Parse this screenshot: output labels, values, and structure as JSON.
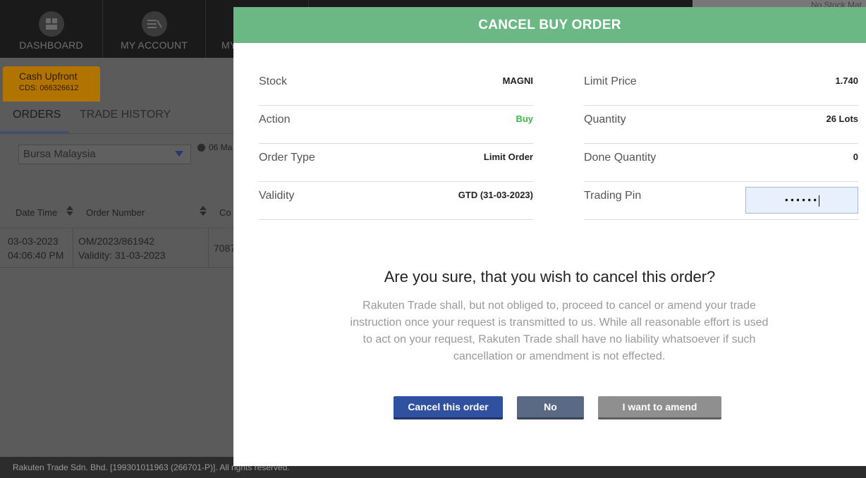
{
  "nav": {
    "items": [
      {
        "label": "DASHBOARD",
        "icon": "dashboard-icon"
      },
      {
        "label": "MY ACCOUNT",
        "icon": "account-icon"
      },
      {
        "label": "MY",
        "icon": ""
      }
    ],
    "top_right_note": "No Stock Mat"
  },
  "account_badge": {
    "title": "Cash Upfront",
    "cds": "CDS: 066326612"
  },
  "tabs": [
    {
      "label": "ORDERS",
      "active": true
    },
    {
      "label": "TRADE HISTORY",
      "active": false
    }
  ],
  "exchange_select": {
    "value": "Bursa Malaysia"
  },
  "date_chip": "06 Ma",
  "orders_table": {
    "headers": [
      "Date Time",
      "Order Number",
      "Co"
    ],
    "rows": [
      {
        "date": "03-03-2023",
        "time": "04:06:40 PM",
        "order_number": "OM/2023/861942",
        "validity": "Validity: 31-03-2023",
        "code": "7087"
      }
    ]
  },
  "footer": "Rakuten Trade Sdn. Bhd. [199301011963 (266701-P)]. All rights reserved.",
  "modal": {
    "title": "CANCEL BUY ORDER",
    "left": [
      {
        "label": "Stock",
        "value": "MAGNI"
      },
      {
        "label": "Action",
        "value": "Buy"
      },
      {
        "label": "Order Type",
        "value": "Limit Order"
      },
      {
        "label": "Validity",
        "value": "GTD (31-03-2023)"
      }
    ],
    "right": [
      {
        "label": "Limit Price",
        "value": "1.740"
      },
      {
        "label": "Quantity",
        "value": "26 Lots"
      },
      {
        "label": "Done Quantity",
        "value": "0"
      },
      {
        "label": "Trading Pin",
        "masked_value": "••••••"
      }
    ],
    "question": "Are you sure, that you wish to cancel this order?",
    "disclaimer": "Rakuten Trade shall, but not obliged to, proceed to cancel or amend your trade instruction once your request is transmitted to us. While all reasonable effort is used to act on your request, Rakuten Trade shall have no liability whatsoever if such cancellation or amendment is not effected.",
    "buttons": {
      "cancel_order": "Cancel this order",
      "no": "No",
      "amend": "I want to amend"
    }
  },
  "colors": {
    "header_green": "#6cb885",
    "buy_green": "#3db545",
    "primary_blue": "#3050a0",
    "badge_orange": "#b27400"
  }
}
